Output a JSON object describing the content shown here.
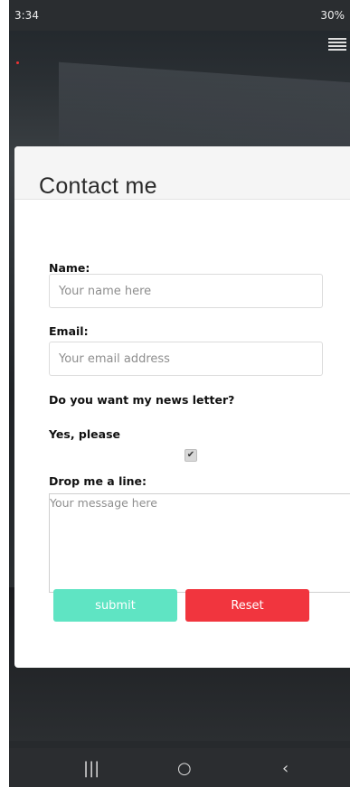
{
  "status_bar": {
    "time": "3:34",
    "right_text": "30%"
  },
  "form": {
    "title": "Contact me",
    "name_label": "Name:",
    "name_placeholder": "Your name here",
    "email_label": "Email:",
    "email_placeholder": "Your email address",
    "newsletter_question": "Do you want my news letter?",
    "newsletter_option": "Yes, please",
    "newsletter_checked": true,
    "message_label": "Drop me a line:",
    "message_placeholder": "Your message here",
    "submit_label": "submit",
    "reset_label": "Reset"
  },
  "colors": {
    "submit": "#5fe4c3",
    "reset": "#f1353e"
  },
  "icons": {
    "menu": "hamburger-icon",
    "checkbox": "checkmark-icon",
    "nav_recent": "recent-apps-icon",
    "nav_home": "home-icon",
    "nav_back": "back-icon"
  }
}
